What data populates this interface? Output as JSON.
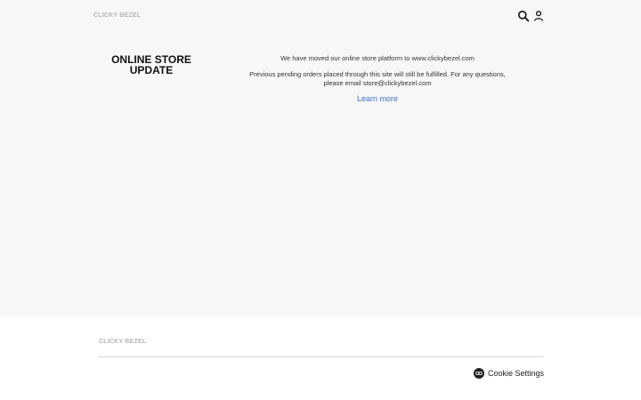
{
  "header": {
    "logo": "CLICKY BEZEL",
    "search_icon": "search-icon",
    "account_icon": "user-icon"
  },
  "main": {
    "heading_line1": "ONLINE STORE",
    "heading_line2": "UPDATE",
    "paragraph1": "We have moved our online store platform to www.clickybezel.com",
    "paragraph2_line1": "Previous pending orders placed through this site will still be fulfilled. For any questions,",
    "paragraph2_line2": "please email store@clickybezel.com",
    "learn_more": "Learn more",
    "link_color": "#3b74c7"
  },
  "footer": {
    "logo": "CLICKY BEZEL",
    "cookie_settings": "Cookie Settings",
    "cookie_icon": "cookie-icon"
  },
  "colors": {
    "page_background": "#f7f7f7",
    "footer_background": "#ffffff",
    "logo_gray": "#b5b5b5"
  }
}
